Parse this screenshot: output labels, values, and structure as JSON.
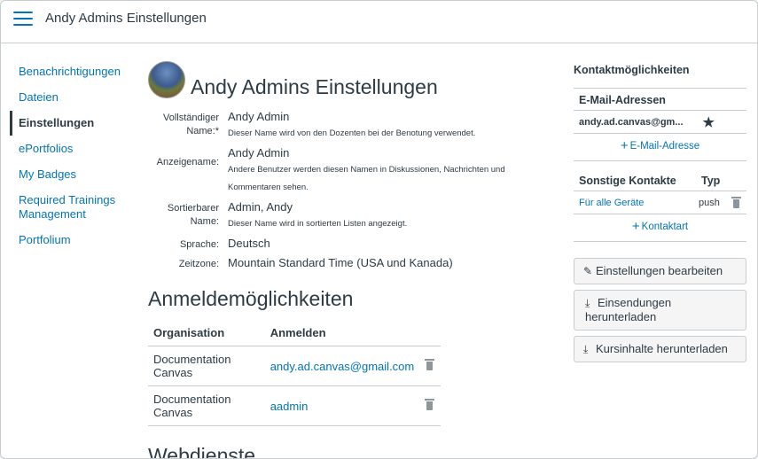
{
  "header": {
    "title": "Andy Admins Einstellungen"
  },
  "sidebar": {
    "items": [
      {
        "label": "Benachrichtigungen",
        "active": false
      },
      {
        "label": "Dateien",
        "active": false
      },
      {
        "label": "Einstellungen",
        "active": true
      },
      {
        "label": "ePortfolios",
        "active": false
      },
      {
        "label": "My Badges",
        "active": false
      },
      {
        "label": "Required Trainings Management",
        "active": false
      },
      {
        "label": "Portfolium",
        "active": false
      }
    ]
  },
  "profile": {
    "title": "Andy Admins Einstellungen",
    "full_name_label": "Vollständiger Name:*",
    "full_name": "Andy Admin",
    "full_name_hint": "Dieser Name wird von den Dozenten bei der Benotung verwendet.",
    "display_name_label": "Anzeigename:",
    "display_name": "Andy Admin",
    "display_name_hint": "Andere Benutzer werden diesen Namen in Diskussionen, Nachrichten und Kommentaren sehen.",
    "sortable_name_label": "Sortierbarer Name:",
    "sortable_name": "Admin, Andy",
    "sortable_name_hint": "Dieser Name wird in sortierten Listen angezeigt.",
    "language_label": "Sprache:",
    "language": "Deutsch",
    "timezone_label": "Zeitzone:",
    "timezone": "Mountain Standard Time (USA und Kanada)"
  },
  "logins": {
    "title": "Anmeldemöglichkeiten",
    "columns": [
      "Organisation",
      "Anmelden"
    ],
    "rows": [
      {
        "organisation": "Documentation Canvas",
        "login": "andy.ad.canvas@gmail.com"
      },
      {
        "organisation": "Documentation Canvas",
        "login": "aadmin"
      }
    ]
  },
  "webservices": {
    "title": "Webdienste"
  },
  "contacts": {
    "title": "Kontaktmöglichkeiten",
    "email_heading": "E-Mail-Adressen",
    "email": "andy.ad.canvas@gm...",
    "add_email": "E-Mail-Adresse",
    "other_heading": "Sonstige Kontakte",
    "type_heading": "Typ",
    "other_rows": [
      {
        "name": "Für alle Geräte",
        "type": "push"
      }
    ],
    "add_contact": "Kontaktart"
  },
  "actions": {
    "edit": "Einstellungen bearbeiten",
    "download_submissions": "Einsendungen herunterladen",
    "download_course": "Kursinhalte herunterladen"
  },
  "colors": {
    "link": "#0374b5",
    "text": "#2d3b45",
    "border": "#c7cdd1"
  }
}
